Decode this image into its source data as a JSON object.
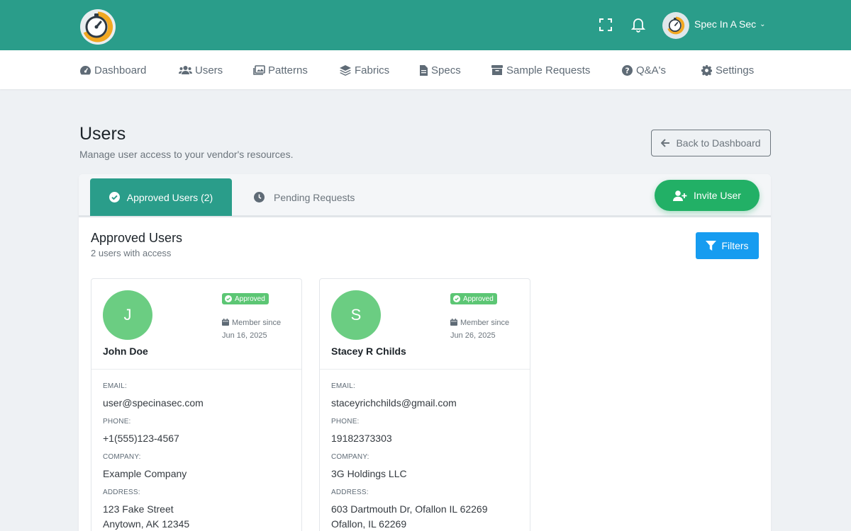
{
  "header": {
    "user_name": "Spec In A Sec"
  },
  "nav": {
    "items": [
      {
        "label": "Dashboard",
        "icon": "gauge-icon"
      },
      {
        "label": "Users",
        "icon": "users-icon"
      },
      {
        "label": "Patterns",
        "icon": "images-icon"
      },
      {
        "label": "Fabrics",
        "icon": "layers-icon"
      },
      {
        "label": "Specs",
        "icon": "file-icon"
      },
      {
        "label": "Sample Requests",
        "icon": "archive-icon"
      },
      {
        "label": "Q&A's",
        "icon": "question-circle-icon"
      },
      {
        "label": "Settings",
        "icon": "gear-icon"
      }
    ]
  },
  "page": {
    "title": "Users",
    "subtitle": "Manage user access to your vendor's resources.",
    "back_label": "Back to Dashboard"
  },
  "tabs": {
    "approved_label": "Approved Users (2)",
    "pending_label": "Pending Requests",
    "invite_label": "Invite User"
  },
  "section": {
    "title": "Approved Users",
    "subtitle": "2 users with access",
    "filters_label": "Filters"
  },
  "labels": {
    "email": "EMAIL:",
    "phone": "PHONE:",
    "company": "COMPANY:",
    "address": "ADDRESS:",
    "member_since": "Member since"
  },
  "users": [
    {
      "initial": "J",
      "name": "John Doe",
      "status": "Approved",
      "member_date": "Jun 16, 2025",
      "email": "user@specinasec.com",
      "phone": "+1(555)123-4567",
      "company": "Example Company",
      "address_line1": "123 Fake Street",
      "address_line2": "Anytown, AK 12345"
    },
    {
      "initial": "S",
      "name": "Stacey R Childs",
      "status": "Approved",
      "member_date": "Jun 26, 2025",
      "email": "staceyrichchilds@gmail.com",
      "phone": "19182373303",
      "company": "3G Holdings LLC",
      "address_line1": "603 Dartmouth Dr, Ofallon IL 62269",
      "address_line2": "Ofallon, IL 62269"
    }
  ],
  "colors": {
    "brand": "#2a9d8a",
    "invite": "#22b066",
    "filters": "#169cf0",
    "approved_badge": "#5cc674",
    "avatar": "#6bcd82"
  }
}
